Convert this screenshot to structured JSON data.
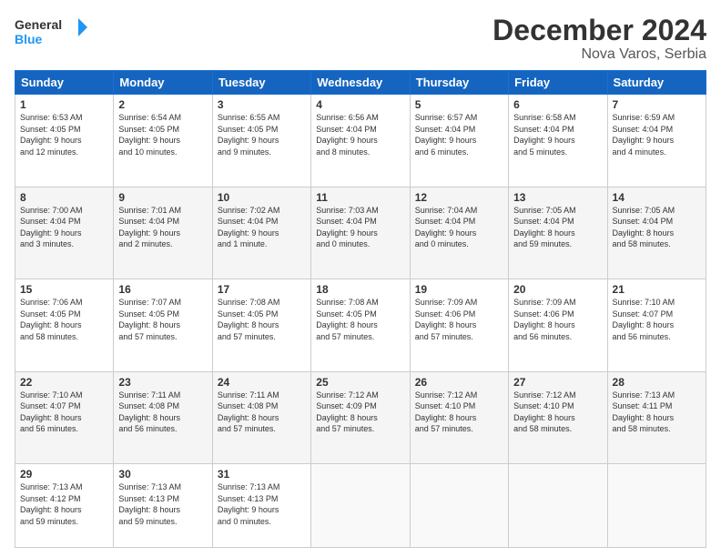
{
  "logo": {
    "line1": "General",
    "line2": "Blue"
  },
  "title": "December 2024",
  "subtitle": "Nova Varos, Serbia",
  "headers": [
    "Sunday",
    "Monday",
    "Tuesday",
    "Wednesday",
    "Thursday",
    "Friday",
    "Saturday"
  ],
  "weeks": [
    [
      {
        "day": "1",
        "info": "Sunrise: 6:53 AM\nSunset: 4:05 PM\nDaylight: 9 hours\nand 12 minutes."
      },
      {
        "day": "2",
        "info": "Sunrise: 6:54 AM\nSunset: 4:05 PM\nDaylight: 9 hours\nand 10 minutes."
      },
      {
        "day": "3",
        "info": "Sunrise: 6:55 AM\nSunset: 4:05 PM\nDaylight: 9 hours\nand 9 minutes."
      },
      {
        "day": "4",
        "info": "Sunrise: 6:56 AM\nSunset: 4:04 PM\nDaylight: 9 hours\nand 8 minutes."
      },
      {
        "day": "5",
        "info": "Sunrise: 6:57 AM\nSunset: 4:04 PM\nDaylight: 9 hours\nand 6 minutes."
      },
      {
        "day": "6",
        "info": "Sunrise: 6:58 AM\nSunset: 4:04 PM\nDaylight: 9 hours\nand 5 minutes."
      },
      {
        "day": "7",
        "info": "Sunrise: 6:59 AM\nSunset: 4:04 PM\nDaylight: 9 hours\nand 4 minutes."
      }
    ],
    [
      {
        "day": "8",
        "info": "Sunrise: 7:00 AM\nSunset: 4:04 PM\nDaylight: 9 hours\nand 3 minutes."
      },
      {
        "day": "9",
        "info": "Sunrise: 7:01 AM\nSunset: 4:04 PM\nDaylight: 9 hours\nand 2 minutes."
      },
      {
        "day": "10",
        "info": "Sunrise: 7:02 AM\nSunset: 4:04 PM\nDaylight: 9 hours\nand 1 minute."
      },
      {
        "day": "11",
        "info": "Sunrise: 7:03 AM\nSunset: 4:04 PM\nDaylight: 9 hours\nand 0 minutes."
      },
      {
        "day": "12",
        "info": "Sunrise: 7:04 AM\nSunset: 4:04 PM\nDaylight: 9 hours\nand 0 minutes."
      },
      {
        "day": "13",
        "info": "Sunrise: 7:05 AM\nSunset: 4:04 PM\nDaylight: 8 hours\nand 59 minutes."
      },
      {
        "day": "14",
        "info": "Sunrise: 7:05 AM\nSunset: 4:04 PM\nDaylight: 8 hours\nand 58 minutes."
      }
    ],
    [
      {
        "day": "15",
        "info": "Sunrise: 7:06 AM\nSunset: 4:05 PM\nDaylight: 8 hours\nand 58 minutes."
      },
      {
        "day": "16",
        "info": "Sunrise: 7:07 AM\nSunset: 4:05 PM\nDaylight: 8 hours\nand 57 minutes."
      },
      {
        "day": "17",
        "info": "Sunrise: 7:08 AM\nSunset: 4:05 PM\nDaylight: 8 hours\nand 57 minutes."
      },
      {
        "day": "18",
        "info": "Sunrise: 7:08 AM\nSunset: 4:05 PM\nDaylight: 8 hours\nand 57 minutes."
      },
      {
        "day": "19",
        "info": "Sunrise: 7:09 AM\nSunset: 4:06 PM\nDaylight: 8 hours\nand 57 minutes."
      },
      {
        "day": "20",
        "info": "Sunrise: 7:09 AM\nSunset: 4:06 PM\nDaylight: 8 hours\nand 56 minutes."
      },
      {
        "day": "21",
        "info": "Sunrise: 7:10 AM\nSunset: 4:07 PM\nDaylight: 8 hours\nand 56 minutes."
      }
    ],
    [
      {
        "day": "22",
        "info": "Sunrise: 7:10 AM\nSunset: 4:07 PM\nDaylight: 8 hours\nand 56 minutes."
      },
      {
        "day": "23",
        "info": "Sunrise: 7:11 AM\nSunset: 4:08 PM\nDaylight: 8 hours\nand 56 minutes."
      },
      {
        "day": "24",
        "info": "Sunrise: 7:11 AM\nSunset: 4:08 PM\nDaylight: 8 hours\nand 57 minutes."
      },
      {
        "day": "25",
        "info": "Sunrise: 7:12 AM\nSunset: 4:09 PM\nDaylight: 8 hours\nand 57 minutes."
      },
      {
        "day": "26",
        "info": "Sunrise: 7:12 AM\nSunset: 4:10 PM\nDaylight: 8 hours\nand 57 minutes."
      },
      {
        "day": "27",
        "info": "Sunrise: 7:12 AM\nSunset: 4:10 PM\nDaylight: 8 hours\nand 58 minutes."
      },
      {
        "day": "28",
        "info": "Sunrise: 7:13 AM\nSunset: 4:11 PM\nDaylight: 8 hours\nand 58 minutes."
      }
    ],
    [
      {
        "day": "29",
        "info": "Sunrise: 7:13 AM\nSunset: 4:12 PM\nDaylight: 8 hours\nand 59 minutes."
      },
      {
        "day": "30",
        "info": "Sunrise: 7:13 AM\nSunset: 4:13 PM\nDaylight: 8 hours\nand 59 minutes."
      },
      {
        "day": "31",
        "info": "Sunrise: 7:13 AM\nSunset: 4:13 PM\nDaylight: 9 hours\nand 0 minutes."
      },
      {
        "day": "",
        "info": ""
      },
      {
        "day": "",
        "info": ""
      },
      {
        "day": "",
        "info": ""
      },
      {
        "day": "",
        "info": ""
      }
    ]
  ]
}
